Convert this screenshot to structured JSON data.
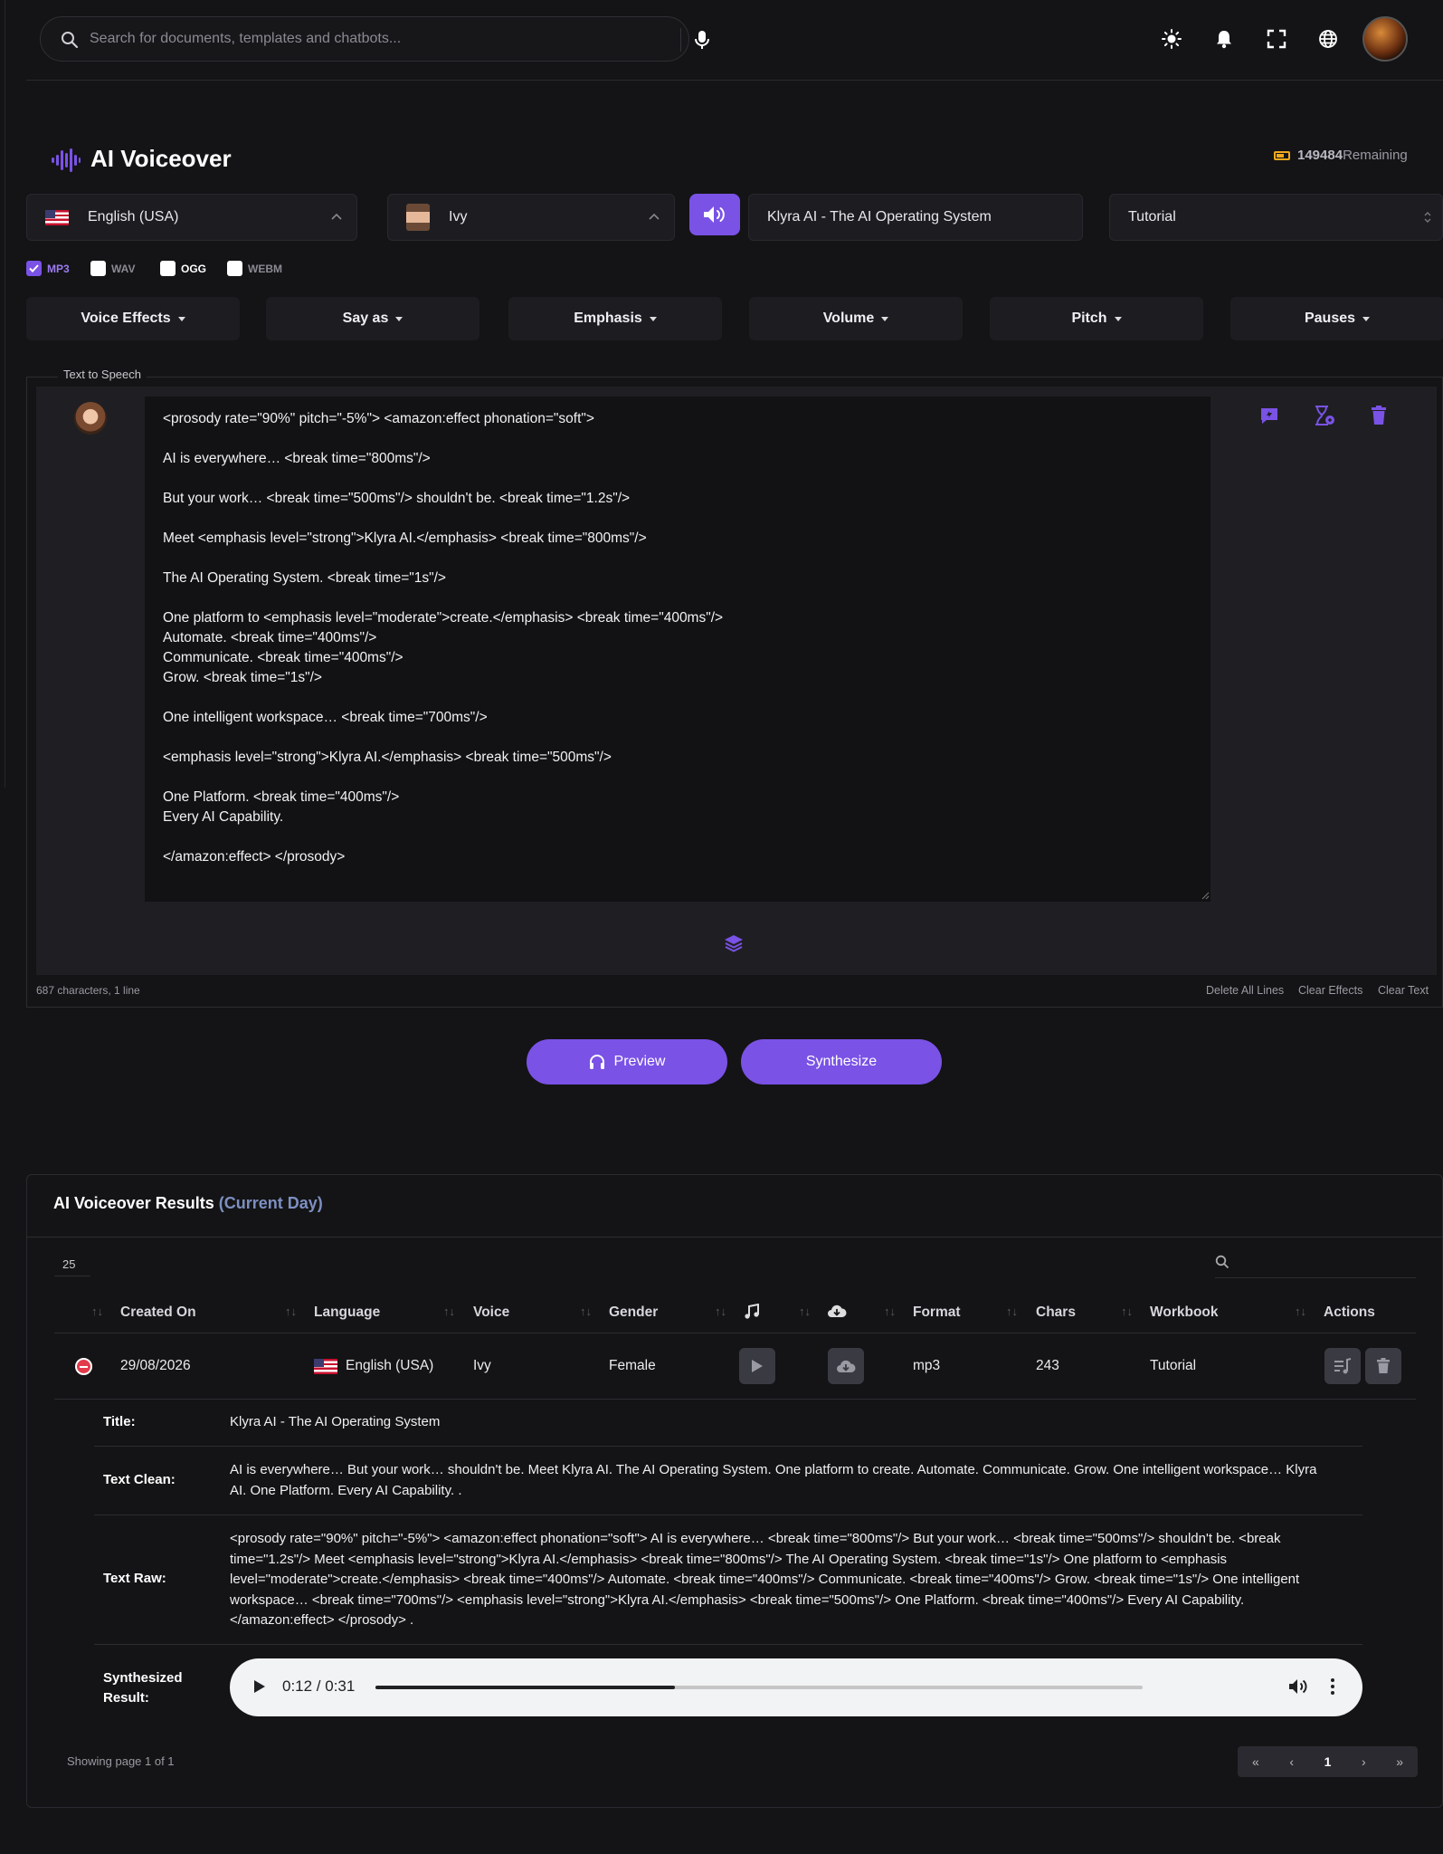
{
  "search": {
    "placeholder": "Search for documents, templates and chatbots..."
  },
  "header": {
    "icons": [
      "sun-icon",
      "bell-icon",
      "fullscreen-icon",
      "globe-icon"
    ],
    "title": "AI Voiceover",
    "credits_value": "149484",
    "credits_label": "Remaining"
  },
  "controls": {
    "language": "English (USA)",
    "voice": "Ivy",
    "title_value": "Klyra AI - The AI Operating System",
    "workbook": "Tutorial",
    "formats": [
      {
        "label": "MP3",
        "checked": true
      },
      {
        "label": "WAV",
        "checked": false
      },
      {
        "label": "OGG",
        "checked": false
      },
      {
        "label": "WEBM",
        "checked": false
      }
    ],
    "dropdowns": [
      "Voice Effects",
      "Say as",
      "Emphasis",
      "Volume",
      "Pitch",
      "Pauses"
    ]
  },
  "tts": {
    "legend": "Text to Speech",
    "text": "<prosody rate=\"90%\" pitch=\"-5%\"> <amazon:effect phonation=\"soft\">\n\nAI is everywhere… <break time=\"800ms\"/>\n\nBut your work… <break time=\"500ms\"/> shouldn't be. <break time=\"1.2s\"/>\n\nMeet <emphasis level=\"strong\">Klyra AI.</emphasis> <break time=\"800ms\"/>\n\nThe AI Operating System. <break time=\"1s\"/>\n\nOne platform to <emphasis level=\"moderate\">create.</emphasis> <break time=\"400ms\"/>\nAutomate. <break time=\"400ms\"/>\nCommunicate. <break time=\"400ms\"/>\nGrow. <break time=\"1s\"/>\n\nOne intelligent workspace… <break time=\"700ms\"/>\n\n<emphasis level=\"strong\">Klyra AI.</emphasis> <break time=\"500ms\"/>\n\nOne Platform. <break time=\"400ms\"/>\nEvery AI Capability.\n\n</amazon:effect> </prosody>",
    "char_count": "687 characters, 1 line",
    "delete_all": "Delete All Lines",
    "clear_effects": "Clear Effects",
    "clear_text": "Clear Text"
  },
  "buttons": {
    "preview": "Preview",
    "synthesize": "Synthesize"
  },
  "results": {
    "title": "AI Voiceover Results",
    "title_suffix": "(Current Day)",
    "page_length": "25",
    "columns": [
      "Created On",
      "Language",
      "Voice",
      "Gender",
      "Format",
      "Chars",
      "Workbook",
      "Actions"
    ],
    "row": {
      "created_on": "29/08/2026",
      "language": "English (USA)",
      "voice": "Ivy",
      "gender": "Female",
      "format": "mp3",
      "chars": "243",
      "workbook": "Tutorial"
    },
    "details": {
      "title_label": "Title:",
      "title_value": "Klyra AI - The AI Operating System",
      "clean_label": "Text Clean:",
      "clean_value": "AI is everywhere… But your work… shouldn't be. Meet Klyra AI. The AI Operating System. One platform to create. Automate. Communicate. Grow. One intelligent workspace… Klyra AI. One Platform. Every AI Capability. .",
      "raw_label": "Text Raw:",
      "raw_value": "<prosody rate=\"90%\" pitch=\"-5%\"> <amazon:effect phonation=\"soft\"> AI is everywhere… <break time=\"800ms\"/> But your work… <break time=\"500ms\"/> shouldn't be. <break time=\"1.2s\"/> Meet <emphasis level=\"strong\">Klyra AI.</emphasis> <break time=\"800ms\"/> The AI Operating System. <break time=\"1s\"/> One platform to <emphasis level=\"moderate\">create.</emphasis> <break time=\"400ms\"/> Automate. <break time=\"400ms\"/> Communicate. <break time=\"400ms\"/> Grow. <break time=\"1s\"/> One intelligent workspace… <break time=\"700ms\"/> <emphasis level=\"strong\">Klyra AI.</emphasis> <break time=\"500ms\"/> One Platform. <break time=\"400ms\"/> Every AI Capability. </amazon:effect> </prosody> .",
      "result_label": "Synthesized Result:",
      "audio_time": "0:12 / 0:31",
      "audio_progress": 0.39
    },
    "showing": "Showing page 1 of 1",
    "current_page": "1"
  },
  "colors": {
    "accent": "#7a52e6",
    "background": "#141416",
    "credits": "#f0a81d",
    "danger": "#e23a4a"
  }
}
